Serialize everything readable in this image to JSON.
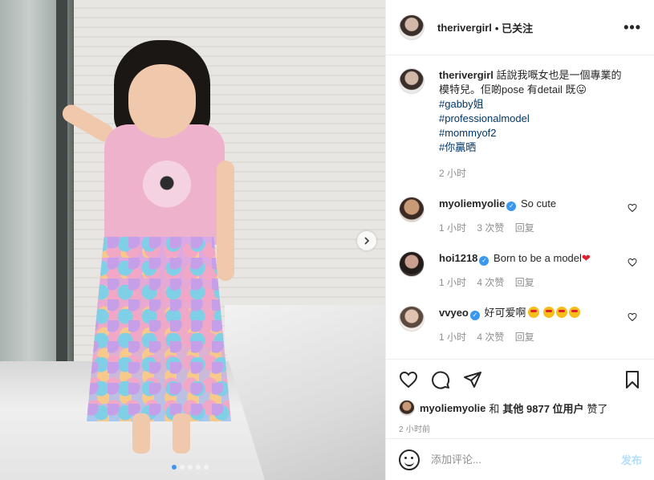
{
  "header": {
    "username": "therivergirl",
    "following_label": "• 已关注",
    "more_icon": "more-horizontal-icon"
  },
  "media": {
    "next_icon": "chevron-right-icon",
    "carousel_count": 5,
    "carousel_active": 0
  },
  "caption": {
    "username": "therivergirl",
    "text": "話說我嘅女也是一個專業的模特兒。佢啲pose 有detail 既😛",
    "hashtags": [
      "#gabby姐",
      "#professionalmodel",
      "#mommyof2",
      "#你贏晒"
    ],
    "time": "2 小时"
  },
  "comments": [
    {
      "username": "myoliemyolie",
      "verified": true,
      "text": "So cute",
      "time": "1 小时",
      "likes": "3 次赞",
      "reply": "回复"
    },
    {
      "username": "hoi1218",
      "verified": true,
      "text": "Born to be a model",
      "heart": "❤",
      "time": "1 小时",
      "likes": "4 次赞",
      "reply": "回复"
    },
    {
      "username": "vvyeo",
      "verified": true,
      "text": "好可爱啊",
      "time": "1 小时",
      "likes": "4 次赞",
      "reply": "回复"
    }
  ],
  "actions": {
    "like_icon": "heart-outline-icon",
    "comment_icon": "comment-icon",
    "share_icon": "paper-plane-icon",
    "save_icon": "bookmark-icon"
  },
  "likes": {
    "first_user": "myoliemyolie",
    "and": "和",
    "others": "其他 9877 位用户",
    "liked": "赞了"
  },
  "time_ago": "2 小时前",
  "comment_box": {
    "placeholder": "添加评论...",
    "post_label": "发布",
    "emoji_icon": "smiley-icon"
  },
  "colors": {
    "link": "#00376b",
    "verified": "#3897f0",
    "post_disabled": "#b2dffc",
    "muted": "#8e8e8e"
  }
}
